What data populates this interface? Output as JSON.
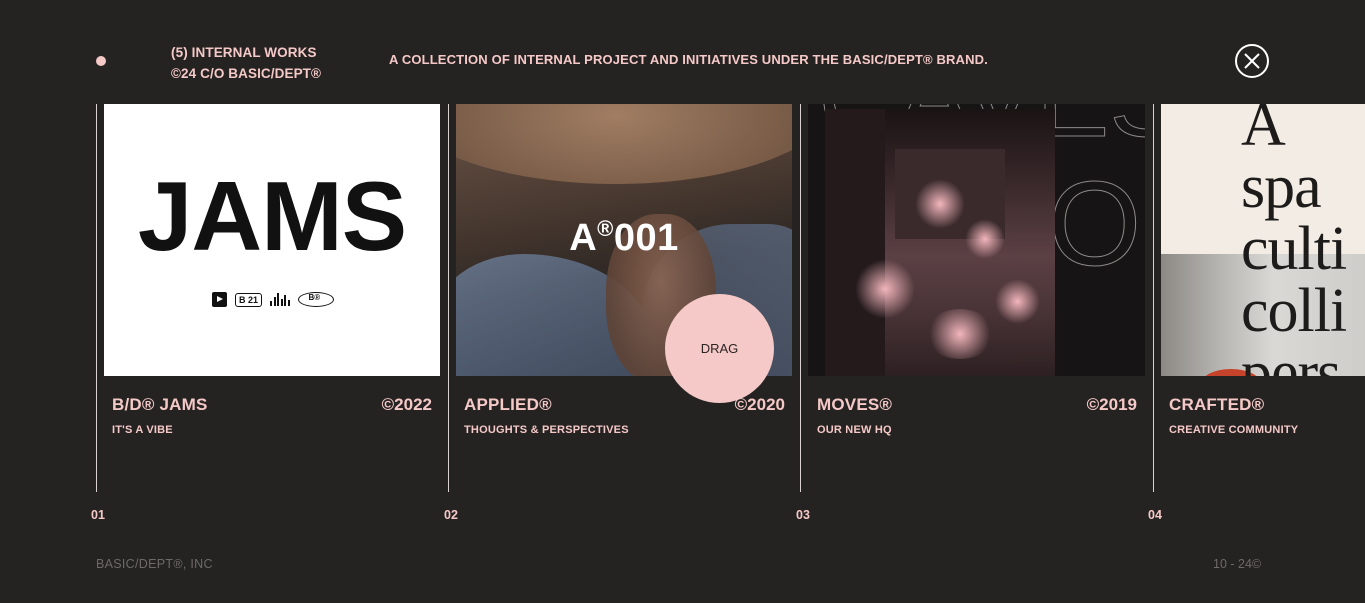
{
  "header": {
    "count_line": "(5) INTERNAL WORKS",
    "brand_line": "©24 C/O BASIC/DEPT®",
    "description": "A COLLECTION OF INTERNAL PROJECT AND INITIATIVES UNDER THE BASIC/DEPT® BRAND."
  },
  "close_icon": "close-icon",
  "cards": [
    {
      "index": "01",
      "title": "B/D® JAMS",
      "year": "©2022",
      "subtitle": "IT'S A VIBE",
      "image_text": "JAMS",
      "badge": "B 21"
    },
    {
      "index": "02",
      "title": "APPLIED®",
      "year": "©2020",
      "subtitle": "THOUGHTS & PERSPECTIVES",
      "image_text_main": "A",
      "image_text_sup": "®",
      "image_text_num": "001"
    },
    {
      "index": "03",
      "title": "MOVES®",
      "year": "©2019",
      "subtitle": "OUR NEW HQ",
      "image_text": "OV"
    },
    {
      "index": "04",
      "title": "CRAFTED®",
      "subtitle": "CREATIVE COMMUNITY",
      "image_text": "A spa\nculti\ncolli\npers"
    }
  ],
  "drag_cursor": "DRAG",
  "footer": {
    "left": "BASIC/DEPT®, INC",
    "right": "10 - 24©"
  },
  "colors": {
    "background": "#252322",
    "accent": "#f5c9c7",
    "muted": "#6d6968"
  }
}
